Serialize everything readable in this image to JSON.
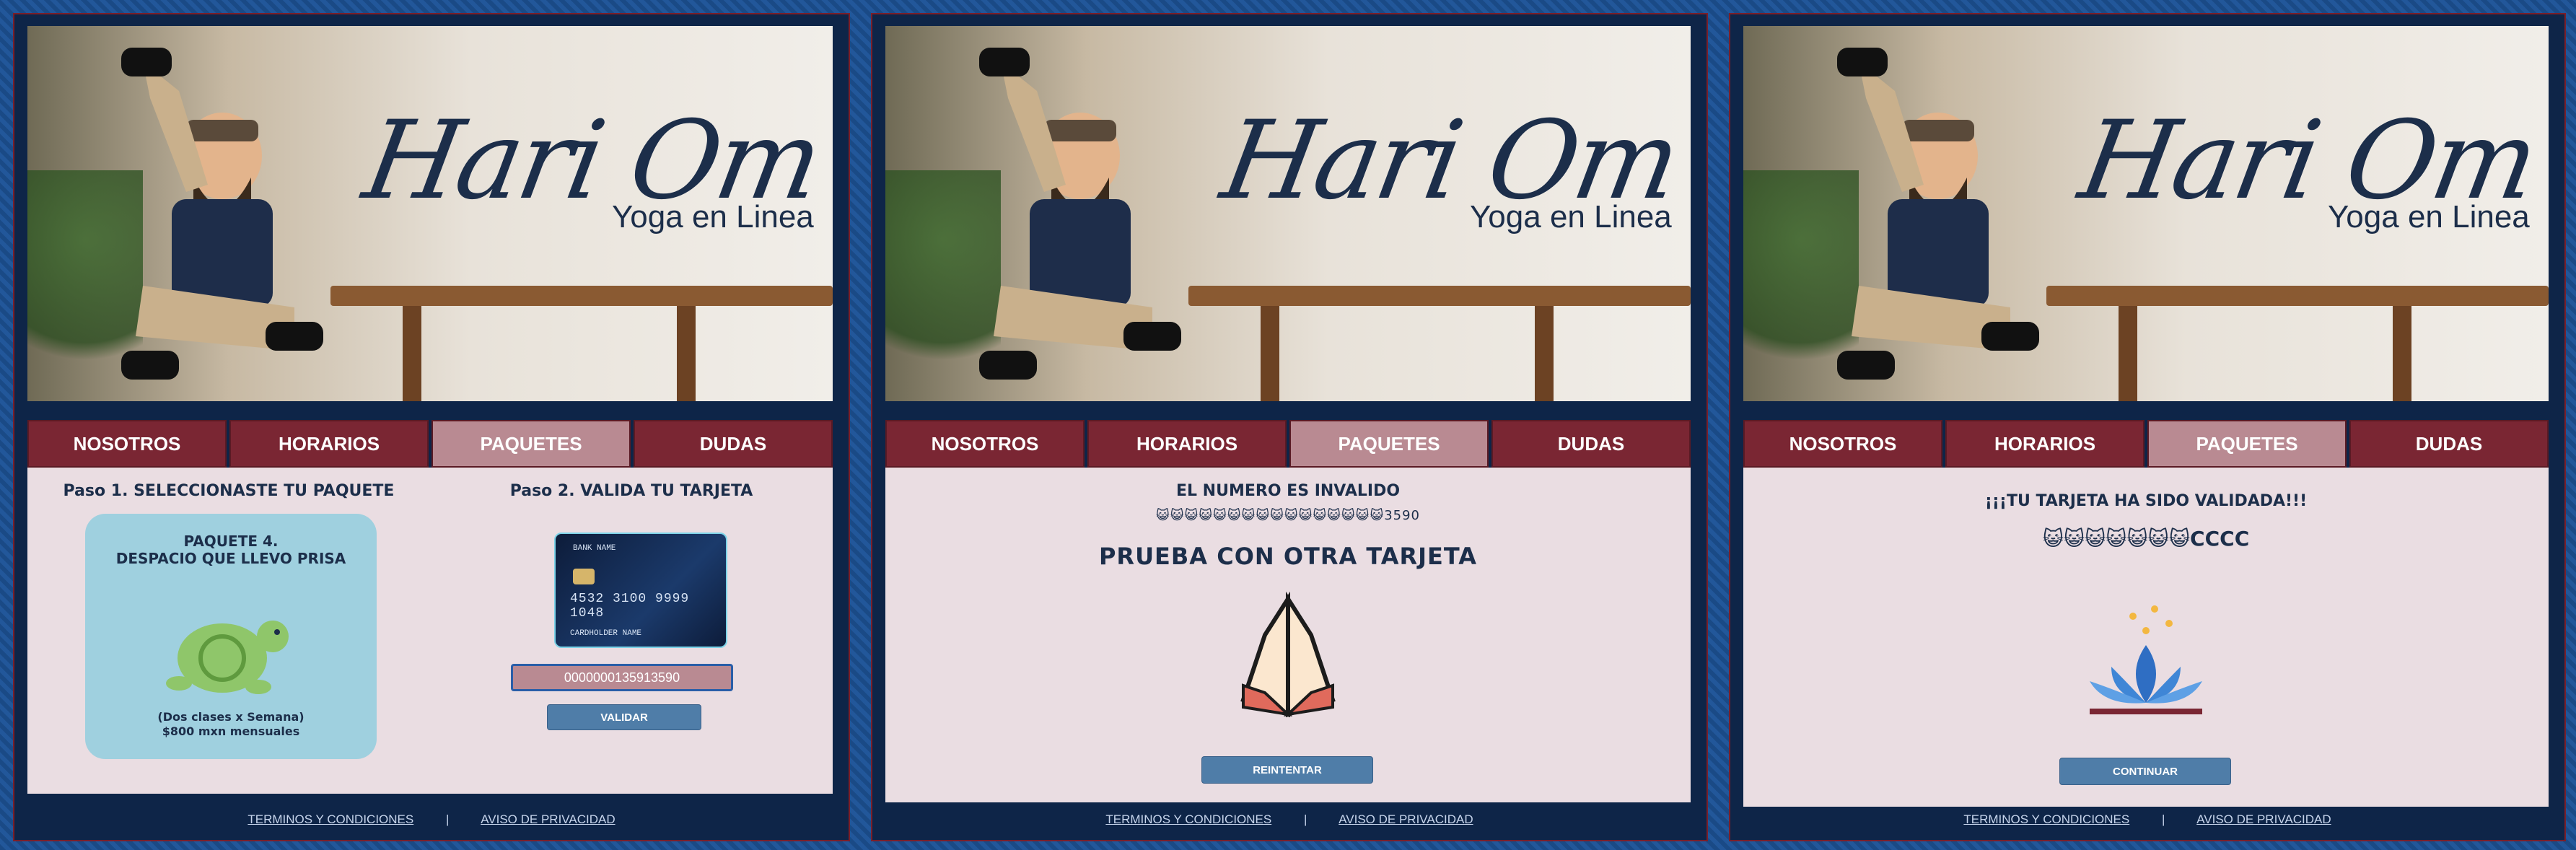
{
  "brand": {
    "title": "Hari Om",
    "subtitle": "Yoga en Linea"
  },
  "nav": {
    "tabs": [
      "NOSOTROS",
      "HORARIOS",
      "PAQUETES",
      "DUDAS"
    ],
    "active": "PAQUETES"
  },
  "footer": {
    "terms": "TERMINOS Y CONDICIONES",
    "separator": "|",
    "privacy": "AVISO DE PRIVACIDAD"
  },
  "panel1": {
    "step1_title": "Paso 1. SELECCIONASTE TU PAQUETE",
    "package_title_line1": "PAQUETE 4.",
    "package_title_line2": "DESPACIO QUE LLEVO PRISA",
    "package_desc_line1": "(Dos clases x Semana)",
    "package_desc_line2": "$800 mxn mensuales",
    "step2_title": "Paso 2. VALIDA TU TARJETA",
    "card_bank": "BANK NAME",
    "card_number": "4532 3100 9999 1048",
    "card_holder": "CARDHOLDER NAME",
    "card_input_value": "0000000135913590",
    "validate_button": "VALIDAR"
  },
  "panel2": {
    "error_title": "EL NUMERO ES INVALIDO",
    "masked_number": "😺😺😺😺😺😺😺😺😺😺😺😺😺😺😺😺3590",
    "retry_message": "PRUEBA CON OTRA TARJETA",
    "retry_button": "REINTENTAR",
    "icon": "praying-hands-icon"
  },
  "panel3": {
    "success_title": "¡¡¡TU TARJETA HA SIDO VALIDADA!!!",
    "masked_number": "😺😺😺😺😺😺😺CCCC",
    "continue_button": "CONTINUAR",
    "icon": "lotus-icon"
  },
  "colors": {
    "nav_bg": "#7a2633",
    "nav_active": "#b98a92",
    "content_bg": "#eadde2",
    "button": "#4f7da8",
    "panel_bg": "#0e2548"
  }
}
